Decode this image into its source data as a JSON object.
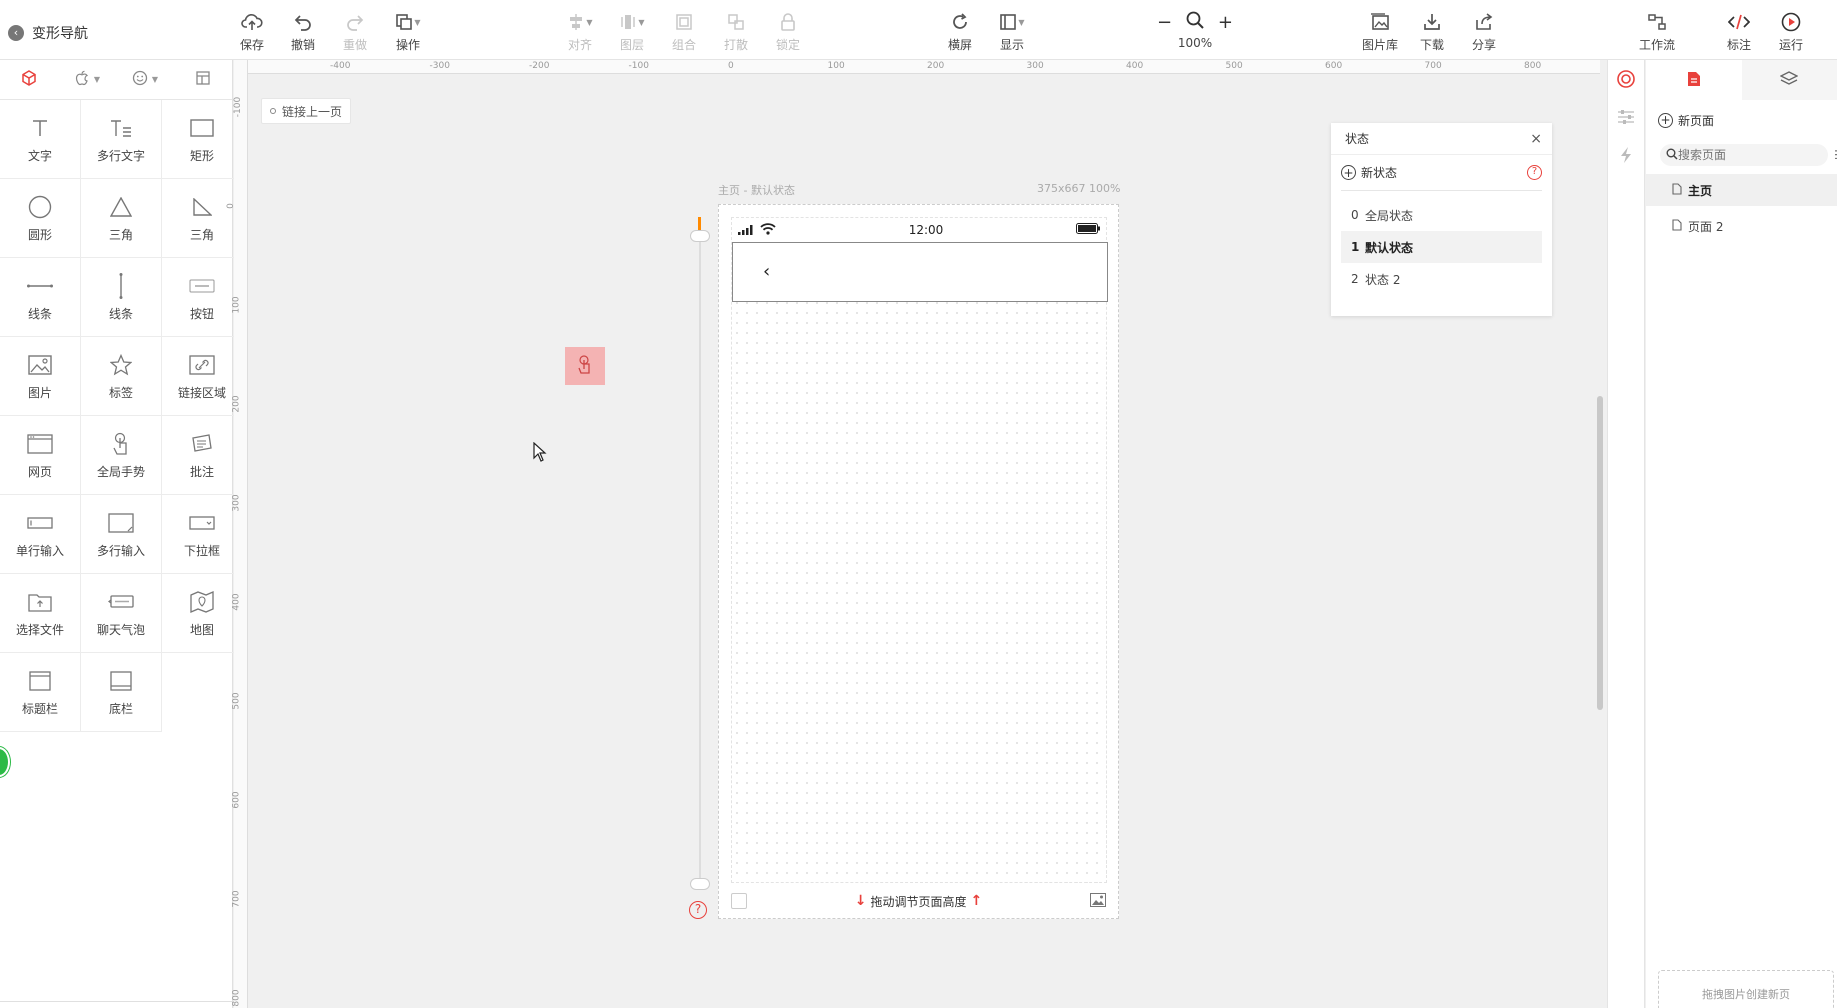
{
  "app": {
    "back_label": "变形导航"
  },
  "toolbar": {
    "save": "保存",
    "undo": "撤销",
    "redo": "重做",
    "operate": "操作",
    "align": "对齐",
    "layer": "图层",
    "group": "组合",
    "ungroup": "打散",
    "lock": "锁定",
    "landscape": "横屏",
    "display": "显示",
    "zoom_out": "−",
    "zoom_in": "+",
    "zoom": "100%",
    "image_lib": "图片库",
    "download": "下载",
    "share": "分享",
    "workflow": "工作流",
    "annotate": "标注",
    "run": "运行"
  },
  "components": [
    {
      "label": "文字",
      "icon": "text-icon"
    },
    {
      "label": "多行文字",
      "icon": "multiline-text-icon"
    },
    {
      "label": "矩形",
      "icon": "rectangle-icon"
    },
    {
      "label": "圆形",
      "icon": "circle-icon"
    },
    {
      "label": "三角",
      "icon": "triangle-icon"
    },
    {
      "label": "三角",
      "icon": "right-triangle-icon"
    },
    {
      "label": "线条",
      "icon": "horizontal-line-icon"
    },
    {
      "label": "线条",
      "icon": "vertical-line-icon"
    },
    {
      "label": "按钮",
      "icon": "button-icon"
    },
    {
      "label": "图片",
      "icon": "image-icon"
    },
    {
      "label": "标签",
      "icon": "star-icon"
    },
    {
      "label": "链接区域",
      "icon": "link-area-icon"
    },
    {
      "label": "网页",
      "icon": "webpage-icon"
    },
    {
      "label": "全局手势",
      "icon": "gesture-icon"
    },
    {
      "label": "批注",
      "icon": "note-icon"
    },
    {
      "label": "单行输入",
      "icon": "single-input-icon"
    },
    {
      "label": "多行输入",
      "icon": "multi-input-icon"
    },
    {
      "label": "下拉框",
      "icon": "dropdown-icon"
    },
    {
      "label": "选择文件",
      "icon": "folder-icon"
    },
    {
      "label": "聊天气泡",
      "icon": "chat-bubble-icon"
    },
    {
      "label": "地图",
      "icon": "map-icon"
    },
    {
      "label": "标题栏",
      "icon": "title-bar-icon"
    },
    {
      "label": "底栏",
      "icon": "bottom-bar-icon"
    }
  ],
  "ruler": {
    "top": [
      "-400",
      "-300",
      "-200",
      "-100",
      "0",
      "100",
      "200",
      "300",
      "400",
      "500",
      "600",
      "700",
      "800"
    ],
    "left": [
      "-100",
      "0",
      "100",
      "200",
      "300",
      "400",
      "500",
      "600",
      "700",
      "800"
    ]
  },
  "canvas": {
    "link_prev": "链接上一页",
    "caption_left": "主页 - 默认状态",
    "caption_right": "375x667 100%"
  },
  "phone": {
    "time": "12:00",
    "back_glyph": "‹",
    "footer_drag": "拖动调节页面高度"
  },
  "states": {
    "title": "状态",
    "close": "×",
    "new_label": "新状态",
    "help": "?",
    "items": [
      {
        "index": "0",
        "label": "全局状态"
      },
      {
        "index": "1",
        "label": "默认状态"
      },
      {
        "index": "2",
        "label": "状态 2"
      }
    ]
  },
  "pages": {
    "new_label": "新页面",
    "search_placeholder": "搜索页面",
    "items": [
      {
        "label": "主页"
      },
      {
        "label": "页面 2"
      }
    ],
    "drop_hint": "拖拽图片创建新页"
  },
  "colors": {
    "accent": "#e8413c",
    "orange": "#ff8a00",
    "gesture_fill": "#f4b3b3",
    "badge_green": "#2cba46"
  }
}
